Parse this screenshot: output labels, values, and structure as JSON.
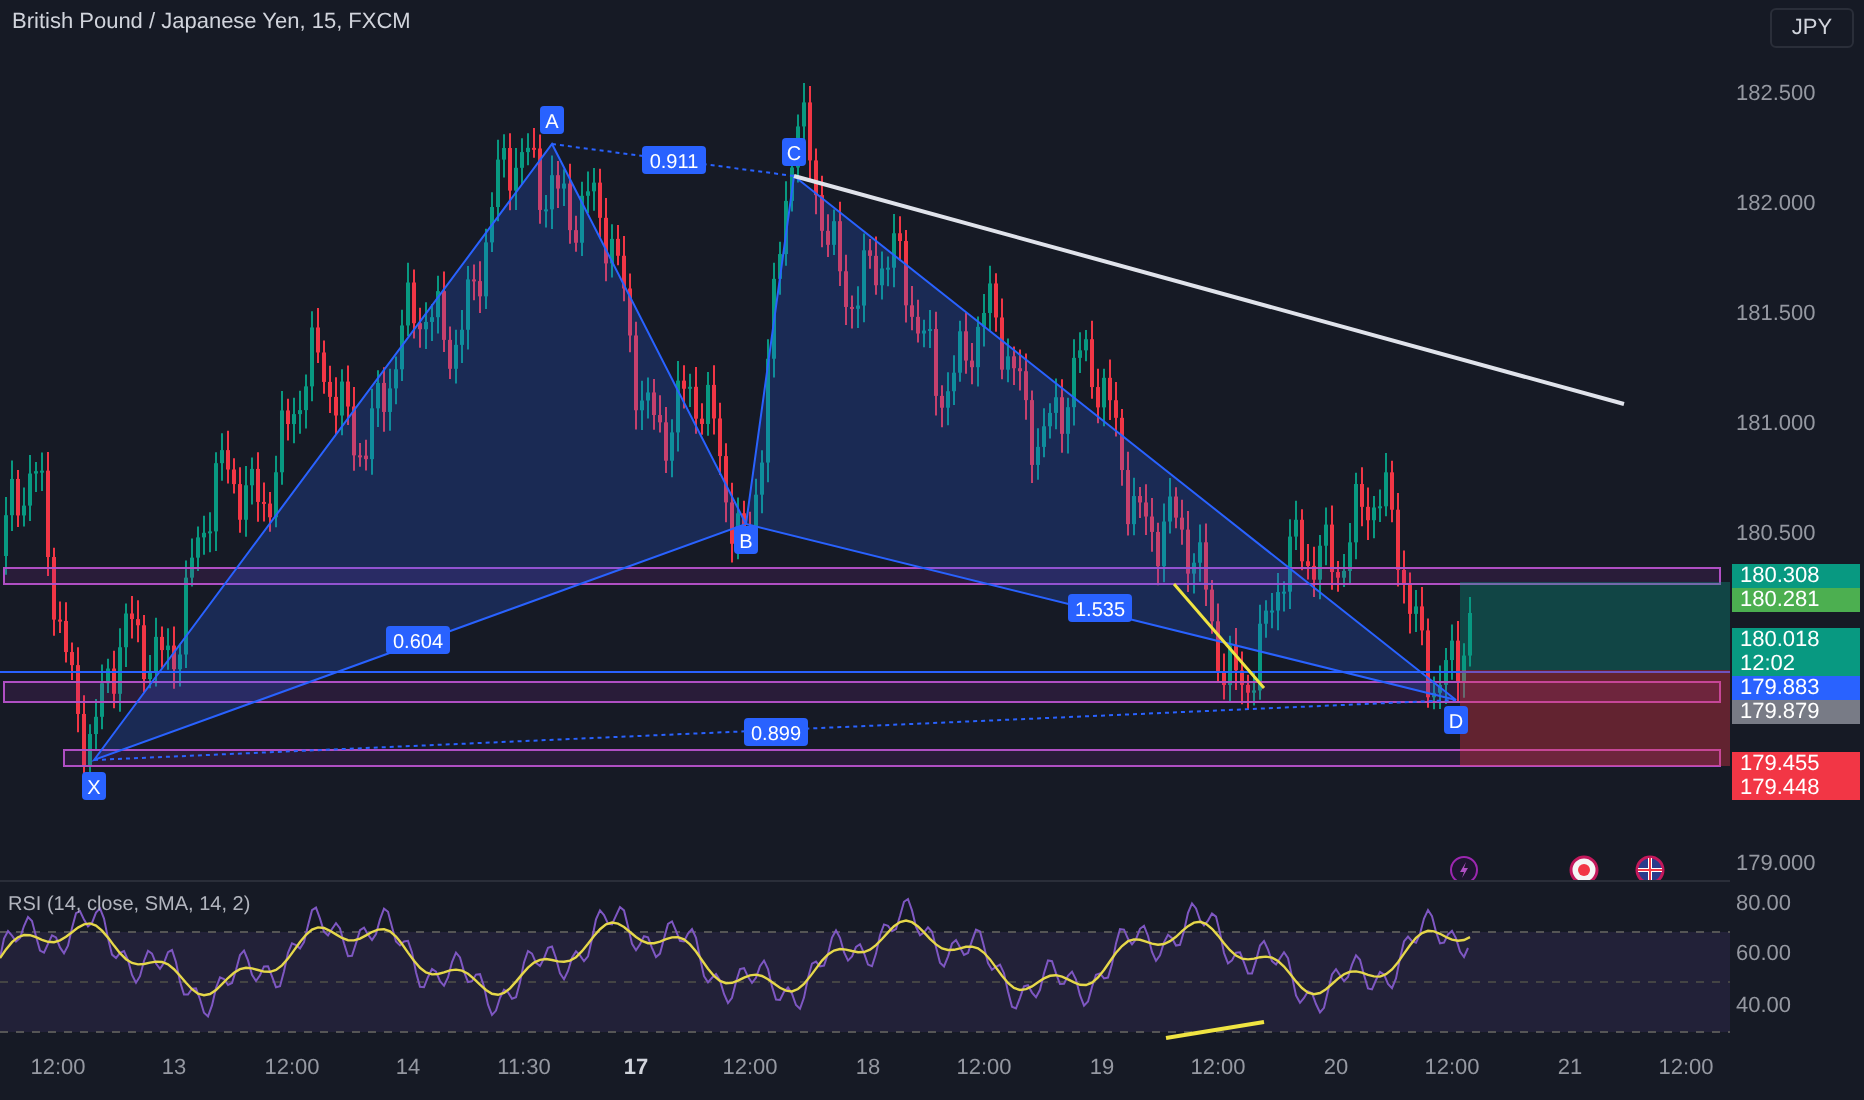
{
  "title": "British Pound / Japanese Yen, 15, FXCM",
  "currency_button": "JPY",
  "pattern_points": [
    {
      "label": "X"
    },
    {
      "label": "A"
    },
    {
      "label": "B"
    },
    {
      "label": "C"
    },
    {
      "label": "D"
    }
  ],
  "pattern_ratios": [
    "0.911",
    "0.604",
    "1.535",
    "0.899"
  ],
  "price_axis": {
    "ticks": [
      "182.500",
      "182.000",
      "181.500",
      "181.000",
      "180.500",
      "179.000"
    ],
    "tags": [
      {
        "price": "180.308",
        "color": "#089981"
      },
      {
        "price": "180.281",
        "color": "#4caf50"
      },
      {
        "price": "180.018",
        "sub": "12:02",
        "color": "#089981"
      },
      {
        "price": "179.883",
        "color": "#2962ff"
      },
      {
        "price": "179.879",
        "color": "#787b86"
      },
      {
        "price": "179.455",
        "color": "#f23645"
      },
      {
        "price": "179.448",
        "color": "#f23645"
      }
    ]
  },
  "rsi": {
    "label": "RSI (14, close, SMA, 14, 2)",
    "ticks": [
      "80.00",
      "60.00",
      "40.00"
    ]
  },
  "time_axis": [
    {
      "label": "12:00",
      "bold": false
    },
    {
      "label": "13",
      "bold": false
    },
    {
      "label": "12:00",
      "bold": false
    },
    {
      "label": "14",
      "bold": false
    },
    {
      "label": "11:30",
      "bold": false
    },
    {
      "label": "17",
      "bold": true
    },
    {
      "label": "12:00",
      "bold": false
    },
    {
      "label": "18",
      "bold": false
    },
    {
      "label": "12:00",
      "bold": false
    },
    {
      "label": "19",
      "bold": false
    },
    {
      "label": "12:00",
      "bold": false
    },
    {
      "label": "20",
      "bold": false
    },
    {
      "label": "12:00",
      "bold": false
    },
    {
      "label": "21",
      "bold": false
    },
    {
      "label": "12:00",
      "bold": false
    }
  ]
}
